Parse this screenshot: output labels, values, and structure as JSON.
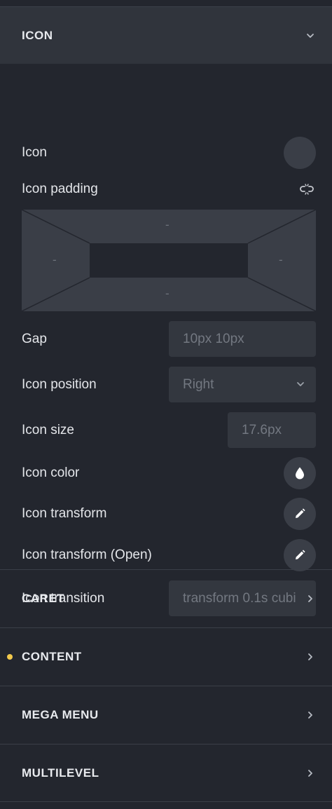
{
  "sections": {
    "icon": {
      "title": "ICON",
      "fields": {
        "icon_label": "Icon",
        "icon_padding_label": "Icon padding",
        "padding": {
          "top": "-",
          "left": "-",
          "right": "-",
          "bottom": "-"
        },
        "gap_label": "Gap",
        "gap_placeholder": "10px 10px",
        "icon_position_label": "Icon position",
        "icon_position_placeholder": "Right",
        "icon_size_label": "Icon size",
        "icon_size_placeholder": "17.6px",
        "icon_color_label": "Icon color",
        "icon_transform_label": "Icon transform",
        "icon_transform_open_label": "Icon transform (Open)",
        "icon_transition_label": "Icon transition",
        "icon_transition_placeholder": "transform 0.1s cubi"
      }
    },
    "caret": {
      "title": "CARET"
    },
    "content": {
      "title": "CONTENT",
      "indicator_color": "#f2c94c"
    },
    "mega_menu": {
      "title": "MEGA MENU"
    },
    "multilevel": {
      "title": "MULTILEVEL"
    }
  },
  "colors": {
    "panel_bg": "#23262e",
    "header_open_bg": "#30343c",
    "field_bg": "#33373f",
    "placeholder_text": "#737881",
    "modified_dot": "#f2c94c"
  },
  "icons": [
    "chevron-down-icon",
    "link-icon",
    "droplet-icon",
    "pencil-icon",
    "chevron-right-icon"
  ]
}
